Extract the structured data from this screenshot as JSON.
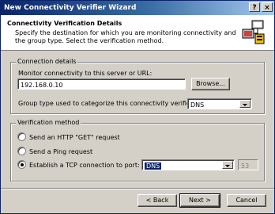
{
  "window": {
    "title": "New Connectivity Verifier Wizard",
    "help_label": "?",
    "close_label": "×"
  },
  "header": {
    "title": "Connectivity Verification Details",
    "description": "Specify the destination for which you are monitoring connectivity and the group type. Select the verification method.",
    "icon": "wizard-network-icon"
  },
  "connection": {
    "group_label": "Connection details",
    "monitor_label": "Monitor connectivity to this server or URL:",
    "monitor_value": "192.168.0.10",
    "browse_label": "Browse...",
    "group_type_label": "Group type used to categorize this connectivity verifier:",
    "group_type_value": "DNS"
  },
  "verification": {
    "group_label": "Verification method",
    "options": [
      {
        "label": "Send an HTTP \"GET\" request",
        "checked": false
      },
      {
        "label": "Send a Ping request",
        "checked": false
      },
      {
        "label": "Establish a TCP connection to port:",
        "checked": true
      }
    ],
    "port_service": "DNS",
    "port_number": "53"
  },
  "footer": {
    "back_label": "< Back",
    "next_label": "Next >",
    "cancel_label": "Cancel"
  },
  "colors": {
    "title_start": "#0a246a",
    "title_end": "#a6caf0",
    "face": "#d4d0c8",
    "selection": "#0a246a"
  }
}
